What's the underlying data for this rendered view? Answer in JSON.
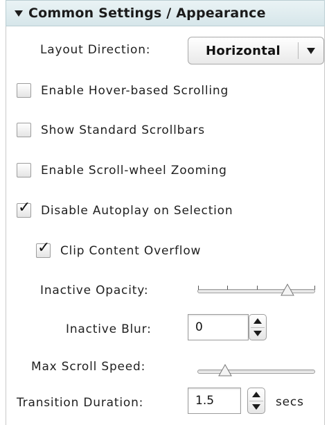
{
  "section": {
    "title": "Common Settings / Appearance"
  },
  "layout_direction": {
    "label": "Layout Direction:",
    "value": "Horizontal"
  },
  "checkboxes": [
    {
      "label": "Enable Hover-based Scrolling",
      "checked": false
    },
    {
      "label": "Show Standard Scrollbars",
      "checked": false
    },
    {
      "label": "Enable Scroll-wheel Zooming",
      "checked": false
    },
    {
      "label": "Disable Autoplay on Selection",
      "checked": true
    },
    {
      "label": "Clip Content Overflow",
      "checked": true
    }
  ],
  "check_glyph": "✓",
  "inactive_opacity": {
    "label": "Inactive Opacity:",
    "level": 0.8
  },
  "inactive_blur": {
    "label": "Inactive Blur:",
    "value": "0"
  },
  "max_scroll_speed": {
    "label": "Max Scroll Speed:",
    "level": 0.2
  },
  "transition_duration": {
    "label": "Transition Duration:",
    "value": "1.5",
    "unit": "secs"
  }
}
